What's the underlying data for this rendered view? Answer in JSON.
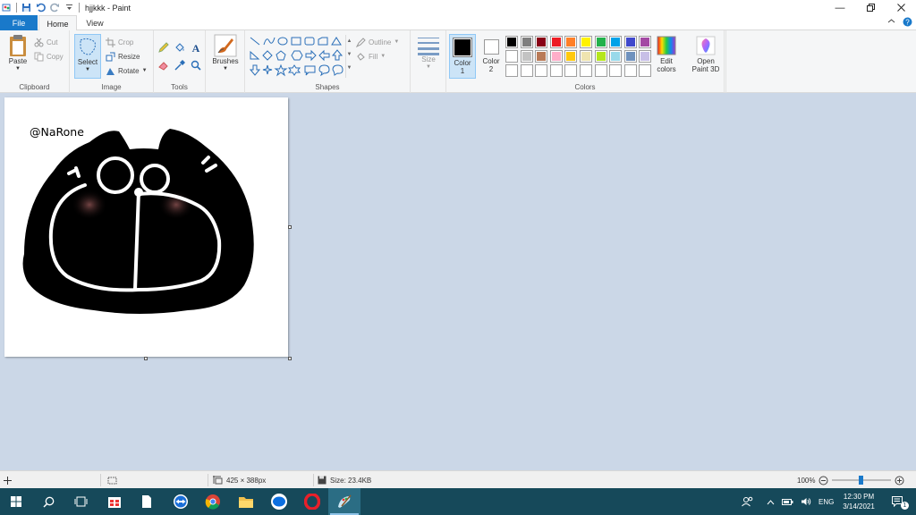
{
  "window": {
    "title": "hjjkkk - Paint"
  },
  "tabs": {
    "file": "File",
    "home": "Home",
    "view": "View"
  },
  "clipboard": {
    "paste": "Paste",
    "cut": "Cut",
    "copy": "Copy",
    "label": "Clipboard"
  },
  "image": {
    "select": "Select",
    "crop": "Crop",
    "resize": "Resize",
    "rotate": "Rotate",
    "label": "Image"
  },
  "tools": {
    "label": "Tools"
  },
  "brushes": {
    "label": "Brushes"
  },
  "shapes": {
    "outline": "Outline",
    "fill": "Fill",
    "label": "Shapes"
  },
  "size": {
    "label": "Size"
  },
  "colors": {
    "color1": "Color 1",
    "color2": "Color 2",
    "edit": "Edit colors",
    "label": "Colors",
    "color1_value": "#000000",
    "color2_value": "#ffffff",
    "palette_row1": [
      "#000000",
      "#7f7f7f",
      "#880015",
      "#ed1c24",
      "#ff7f27",
      "#fff200",
      "#22b14c",
      "#00a2e8",
      "#3f48cc",
      "#a349a4"
    ],
    "palette_row2": [
      "#ffffff",
      "#c3c3c3",
      "#b97a57",
      "#ffaec9",
      "#ffc90e",
      "#efe4b0",
      "#b5e61d",
      "#99d9ea",
      "#7092be",
      "#c8bfe7"
    ]
  },
  "paint3d": {
    "label": "Open Paint 3D"
  },
  "canvas": {
    "signature": "@NaRone"
  },
  "status": {
    "dimensions": "425 × 388px",
    "size": "Size: 23.4KB",
    "zoom": "100%"
  },
  "taskbar": {
    "lang": "ENG",
    "time": "12:30 PM",
    "date": "3/14/2021",
    "notifications": "1"
  }
}
